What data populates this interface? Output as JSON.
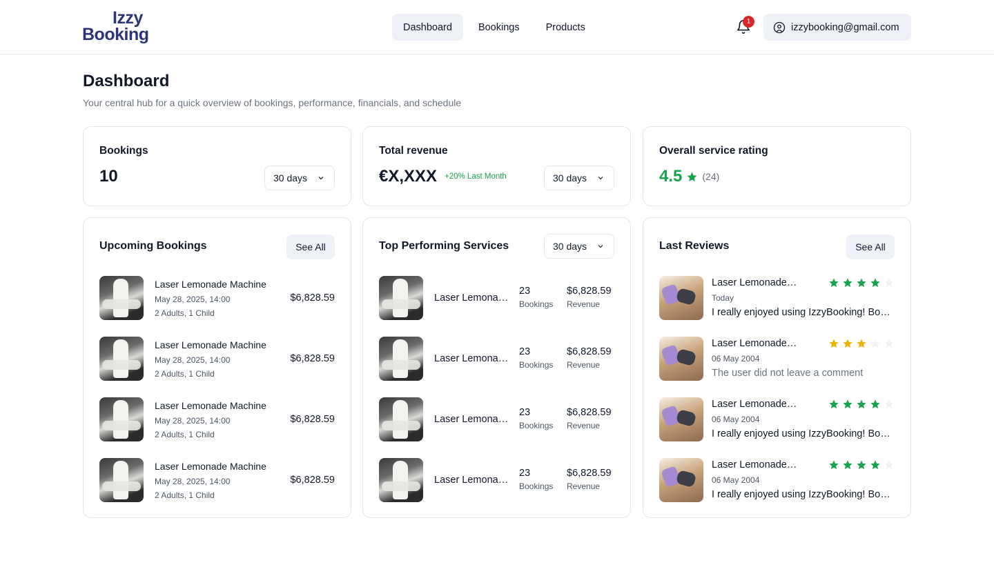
{
  "brand": {
    "line1": "Izzy",
    "line2": "Booking"
  },
  "nav": [
    {
      "label": "Dashboard",
      "active": true
    },
    {
      "label": "Bookings",
      "active": false
    },
    {
      "label": "Products",
      "active": false
    }
  ],
  "notifications": {
    "icon": "bell-icon",
    "count": "1"
  },
  "account": {
    "icon": "user-circle-icon",
    "email": "izzybooking@gmail.com"
  },
  "page": {
    "title": "Dashboard",
    "subtitle": "Your central hub for a quick overview of bookings, performance, financials, and schedule"
  },
  "stats": {
    "bookings": {
      "title": "Bookings",
      "value": "10",
      "range": "30 days"
    },
    "revenue": {
      "title": "Total revenue",
      "value": "€X,XXX",
      "delta": "+20% Last Month",
      "range": "30 days"
    },
    "rating": {
      "title": "Overall service rating",
      "value": "4.5",
      "count": "(24)",
      "star_color": "#16a34a"
    }
  },
  "upcoming": {
    "title": "Upcoming Bookings",
    "see_all": "See All",
    "items": [
      {
        "name": "Laser Lemonade Machine",
        "date": "May 28, 2025, 14:00",
        "guests": "2 Adults, 1 Child",
        "price": "$6,828.59"
      },
      {
        "name": "Laser Lemonade Machine",
        "date": "May 28, 2025, 14:00",
        "guests": "2 Adults, 1 Child",
        "price": "$6,828.59"
      },
      {
        "name": "Laser Lemonade Machine",
        "date": "May 28, 2025, 14:00",
        "guests": "2 Adults, 1 Child",
        "price": "$6,828.59"
      },
      {
        "name": "Laser Lemonade Machine",
        "date": "May 28, 2025, 14:00",
        "guests": "2 Adults, 1 Child",
        "price": "$6,828.59"
      }
    ]
  },
  "top_services": {
    "title": "Top Performing Services",
    "range": "30 days",
    "items": [
      {
        "name": "Laser Lemonade Machine",
        "bookings": "23",
        "bookings_label": "Bookings",
        "revenue": "$6,828.59",
        "revenue_label": "Revenue"
      },
      {
        "name": "Laser Lemonade Machine",
        "bookings": "23",
        "bookings_label": "Bookings",
        "revenue": "$6,828.59",
        "revenue_label": "Revenue"
      },
      {
        "name": "Laser Lemonade Machine",
        "bookings": "23",
        "bookings_label": "Bookings",
        "revenue": "$6,828.59",
        "revenue_label": "Revenue"
      },
      {
        "name": "Laser Lemonade Machine",
        "bookings": "23",
        "bookings_label": "Bookings",
        "revenue": "$6,828.59",
        "revenue_label": "Revenue"
      }
    ]
  },
  "reviews": {
    "title": "Last Reviews",
    "see_all": "See All",
    "items": [
      {
        "name": "Laser Lemonade Machine",
        "date": "Today",
        "text": "I really enjoyed using IzzyBooking! Booking was quick and easy.",
        "stars": 4,
        "star_color": "#16a34a",
        "muted": false
      },
      {
        "name": "Laser Lemonade Machine",
        "date": "06 May 2004",
        "text": "The user did not leave a comment",
        "stars": 3,
        "star_color": "#eab308",
        "muted": true
      },
      {
        "name": "Laser Lemonade Machine",
        "date": "06 May 2004",
        "text": "I really enjoyed using IzzyBooking! Booking was quick and easy.",
        "stars": 4,
        "star_color": "#16a34a",
        "muted": false
      },
      {
        "name": "Laser Lemonade Machine",
        "date": "06 May 2004",
        "text": "I really enjoyed using IzzyBooking! Booking was quick and easy.",
        "stars": 4,
        "star_color": "#16a34a",
        "muted": false
      }
    ]
  }
}
